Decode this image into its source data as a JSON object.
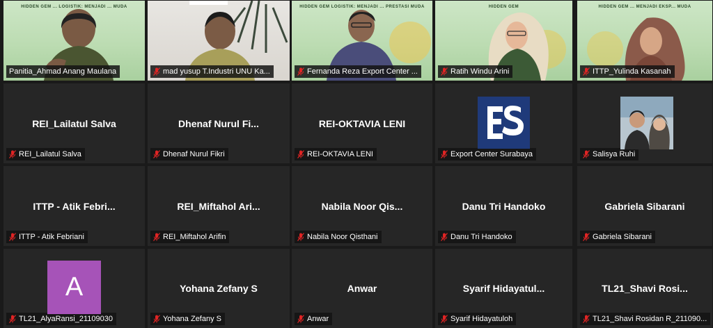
{
  "participants": [
    {
      "tile_name": "Panitia_Ahmad Anang Maulana",
      "label": "Panitia_Ahmad Anang Maulana",
      "muted": false,
      "video": true,
      "active": true,
      "banner": "HIDDEN GEM ... LOGISTIK: MENJADI ... MUDA"
    },
    {
      "tile_name": "mad yusup T.Industri UNU Ka...",
      "label": "mad yusup T.Industri UNU Ka...",
      "muted": true,
      "video": true
    },
    {
      "tile_name": "Fernanda Reza Export Center ...",
      "label": "Fernanda Reza Export Center ...",
      "muted": true,
      "video": true,
      "banner": "HIDDEN GEM LOGISTIK: MENJADI ... PRESTASI MUDA"
    },
    {
      "tile_name": "Ratih Windu Arini",
      "label": "Ratih Windu Arini",
      "muted": true,
      "video": true,
      "banner": "HIDDEN GEM"
    },
    {
      "tile_name": "ITTP_Yulinda Kasanah",
      "label": "ITTP_Yulinda Kasanah",
      "muted": true,
      "video": true,
      "banner": "HIDDEN GEM ... MENJADI EKSP... MUDA"
    },
    {
      "display": "REI_Lailatul Salva",
      "label": "REI_Lailatul Salva",
      "muted": true
    },
    {
      "display": "Dhenaf  Nurul  Fi...",
      "label": "Dhenaf Nurul Fikri",
      "muted": true
    },
    {
      "display": "REI-OKTAVIA LENI",
      "label": "REI-OKTAVIA LENI",
      "muted": true
    },
    {
      "display": "",
      "label": "Export Center Surabaya",
      "muted": true,
      "avatar": "es-logo-icon"
    },
    {
      "display": "",
      "label": "Salisya Ruhi",
      "muted": true,
      "avatar": "profile-photo"
    },
    {
      "display": "ITTP  -  Atik Febri...",
      "label": "ITTP - Atik Febriani",
      "muted": true
    },
    {
      "display": "REI_Miftahol  Ari...",
      "label": "REI_Miftahol Arifin",
      "muted": true
    },
    {
      "display": "Nabila  Noor  Qis...",
      "label": "Nabila Noor Qisthani",
      "muted": true
    },
    {
      "display": "Danu Tri Handoko",
      "label": "Danu Tri Handoko",
      "muted": true
    },
    {
      "display": "Gabriela Sibarani",
      "label": "Gabriela Sibarani",
      "muted": true
    },
    {
      "display": "",
      "label": "TL21_AlyaRansi_21109030",
      "muted": true,
      "avatar_letter": "A"
    },
    {
      "display": "Yohana Zefany S",
      "label": "Yohana Zefany S",
      "muted": true
    },
    {
      "display": "Anwar",
      "label": "Anwar",
      "muted": true
    },
    {
      "display": "Syarif  Hidayatul...",
      "label": "Syarif Hidayatuloh",
      "muted": true
    },
    {
      "display": "TL21_Shavi  Rosi...",
      "label": "TL21_Shavi Rosidan R_211090...",
      "muted": true
    }
  ],
  "colors": {
    "tile_bg": "#262626",
    "active_border": "#e6d44a",
    "mute_red": "#e02424",
    "avatar_purple": "#a653b8",
    "es_logo_blue": "#1f3a7a"
  },
  "icons": {
    "muted": "mic-muted-icon"
  }
}
